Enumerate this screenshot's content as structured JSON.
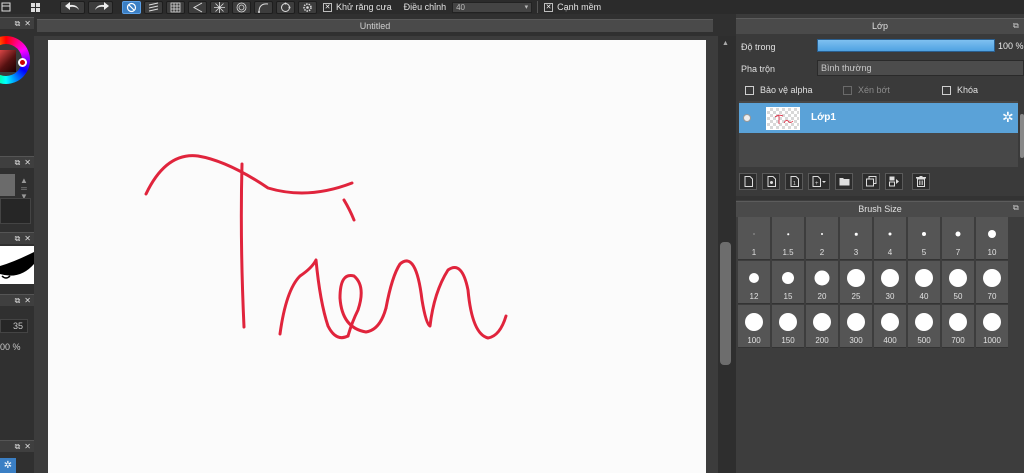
{
  "toolbar": {
    "antialias_label": "Khử răng cưa",
    "correction_label": "Điều chỉnh",
    "correction_value": "40",
    "soft_edge_label": "Cạnh mềm"
  },
  "document": {
    "title": "Untitled",
    "drawing_text": "Tròn",
    "stroke_color": "#e0243c"
  },
  "left_panel": {
    "value_35": "35",
    "value_100": "00 %"
  },
  "layer_panel": {
    "title": "Lớp",
    "opacity_label": "Độ trong",
    "opacity_value": "100 %",
    "opacity_fraction": 1.0,
    "blend_label": "Pha trộn",
    "blend_value": "Bình thường",
    "protect_alpha": "Bảo vệ alpha",
    "clipping": "Xén bớt",
    "lock": "Khóa",
    "layers": [
      {
        "name": "Lớp1",
        "selected": true
      }
    ]
  },
  "brush_panel": {
    "title": "Brush Size",
    "sizes": [
      {
        "label": "1",
        "d": 1
      },
      {
        "label": "1.5",
        "d": 1.5
      },
      {
        "label": "2",
        "d": 2
      },
      {
        "label": "3",
        "d": 2.5
      },
      {
        "label": "4",
        "d": 3
      },
      {
        "label": "5",
        "d": 4
      },
      {
        "label": "7",
        "d": 5
      },
      {
        "label": "10",
        "d": 8
      },
      {
        "label": "12",
        "d": 10
      },
      {
        "label": "15",
        "d": 12
      },
      {
        "label": "20",
        "d": 15
      },
      {
        "label": "25",
        "d": 18
      },
      {
        "label": "30",
        "d": 18
      },
      {
        "label": "40",
        "d": 18
      },
      {
        "label": "50",
        "d": 18
      },
      {
        "label": "70",
        "d": 18
      },
      {
        "label": "100",
        "d": 18
      },
      {
        "label": "150",
        "d": 18
      },
      {
        "label": "200",
        "d": 18
      },
      {
        "label": "300",
        "d": 18
      },
      {
        "label": "400",
        "d": 18
      },
      {
        "label": "500",
        "d": 18
      },
      {
        "label": "700",
        "d": 18
      },
      {
        "label": "1000",
        "d": 18
      }
    ]
  },
  "colors": {
    "accent": "#3b7fc4",
    "layer_selected": "#5aa2d8",
    "opacity_fill": "#6db4ec"
  }
}
